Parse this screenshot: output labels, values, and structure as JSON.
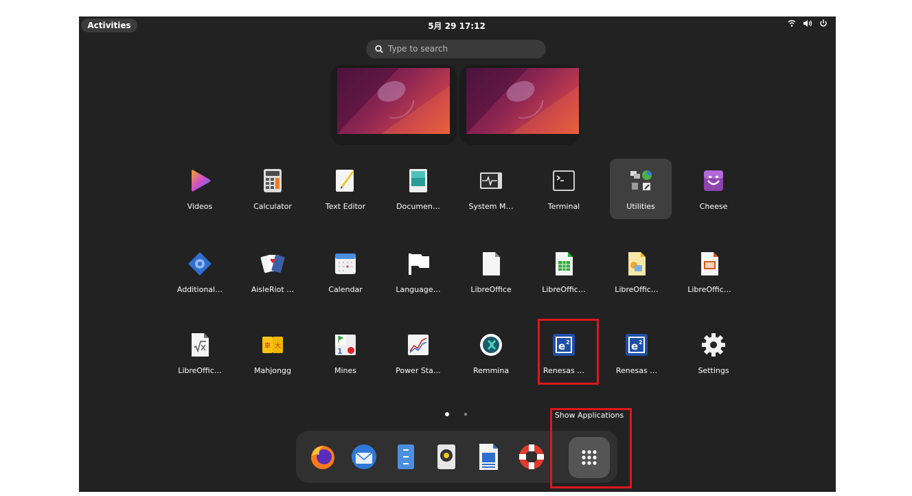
{
  "topbar": {
    "activities": "Activities",
    "clock": "5月 29 17:12",
    "tray_icons": [
      "wifi-icon",
      "volume-icon",
      "power-icon"
    ]
  },
  "search": {
    "placeholder": "Type to search"
  },
  "workspaces": [
    "workspace-1",
    "workspace-2"
  ],
  "apps": [
    {
      "label": "Videos",
      "icon": "videos-icon"
    },
    {
      "label": "Calculator",
      "icon": "calculator-icon"
    },
    {
      "label": "Text Editor",
      "icon": "text-editor-icon"
    },
    {
      "label": "Documen…",
      "icon": "document-viewer-icon"
    },
    {
      "label": "System M…",
      "icon": "system-monitor-icon"
    },
    {
      "label": "Terminal",
      "icon": "terminal-icon"
    },
    {
      "label": "Utilities",
      "icon": "utilities-folder-icon"
    },
    {
      "label": "Cheese",
      "icon": "cheese-icon"
    },
    {
      "label": "Additional…",
      "icon": "additional-drivers-icon"
    },
    {
      "label": "AisleRiot …",
      "icon": "aisleriot-icon"
    },
    {
      "label": "Calendar",
      "icon": "calendar-icon"
    },
    {
      "label": "Language…",
      "icon": "language-support-icon"
    },
    {
      "label": "LibreOffice",
      "icon": "libreoffice-icon"
    },
    {
      "label": "LibreOffic…",
      "icon": "libreoffice-calc-icon"
    },
    {
      "label": "LibreOffic…",
      "icon": "libreoffice-draw-icon"
    },
    {
      "label": "LibreOffic…",
      "icon": "libreoffice-impress-icon"
    },
    {
      "label": "LibreOffic…",
      "icon": "libreoffice-math-icon"
    },
    {
      "label": "Mahjongg",
      "icon": "mahjongg-icon"
    },
    {
      "label": "Mines",
      "icon": "mines-icon"
    },
    {
      "label": "Power Sta…",
      "icon": "power-statistics-icon"
    },
    {
      "label": "Remmina",
      "icon": "remmina-icon"
    },
    {
      "label": "Renesas …",
      "icon": "renesas-e2-icon"
    },
    {
      "label": "Renesas …",
      "icon": "renesas-e2-icon"
    },
    {
      "label": "Settings",
      "icon": "settings-icon"
    }
  ],
  "page_indicator": {
    "pages": 2,
    "current": 1
  },
  "dock": {
    "items": [
      "firefox-icon",
      "thunderbird-icon",
      "files-icon",
      "rhythmbox-icon",
      "libreoffice-writer-icon",
      "help-icon",
      "show-applications-icon"
    ],
    "tooltip": "Show Applications"
  },
  "colors": {
    "annotation": "#e0161b",
    "panel": "#222222",
    "highlight": "#3f3f3f"
  }
}
